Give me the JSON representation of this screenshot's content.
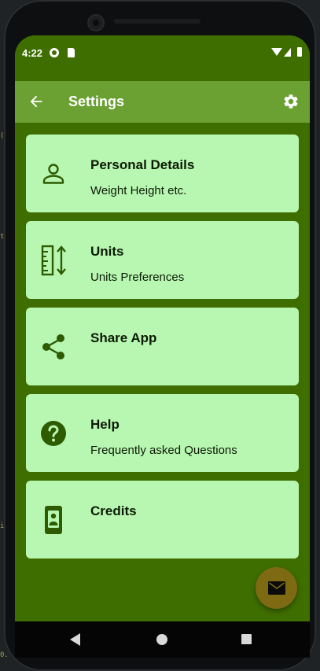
{
  "status_bar": {
    "time": "4:22"
  },
  "app_bar": {
    "title": "Settings"
  },
  "cards": [
    {
      "label": "Personal Details",
      "subtitle": "Weight Height etc.",
      "icon": "person-icon"
    },
    {
      "label": "Units",
      "subtitle": "Units Preferences",
      "icon": "ruler-icon"
    },
    {
      "label": "Share App",
      "subtitle": "",
      "icon": "share-icon"
    },
    {
      "label": "Help",
      "subtitle": "Frequently asked Questions",
      "icon": "help-icon"
    },
    {
      "label": "Credits",
      "subtitle": "",
      "icon": "badge-icon"
    }
  ],
  "colors": {
    "primary": "#3e6d00",
    "app_bar": "#6aa132",
    "card": "#b8f7b2",
    "icon": "#2e5a00",
    "fab": "#7d6a13"
  },
  "fab": {
    "icon": "email-icon"
  }
}
